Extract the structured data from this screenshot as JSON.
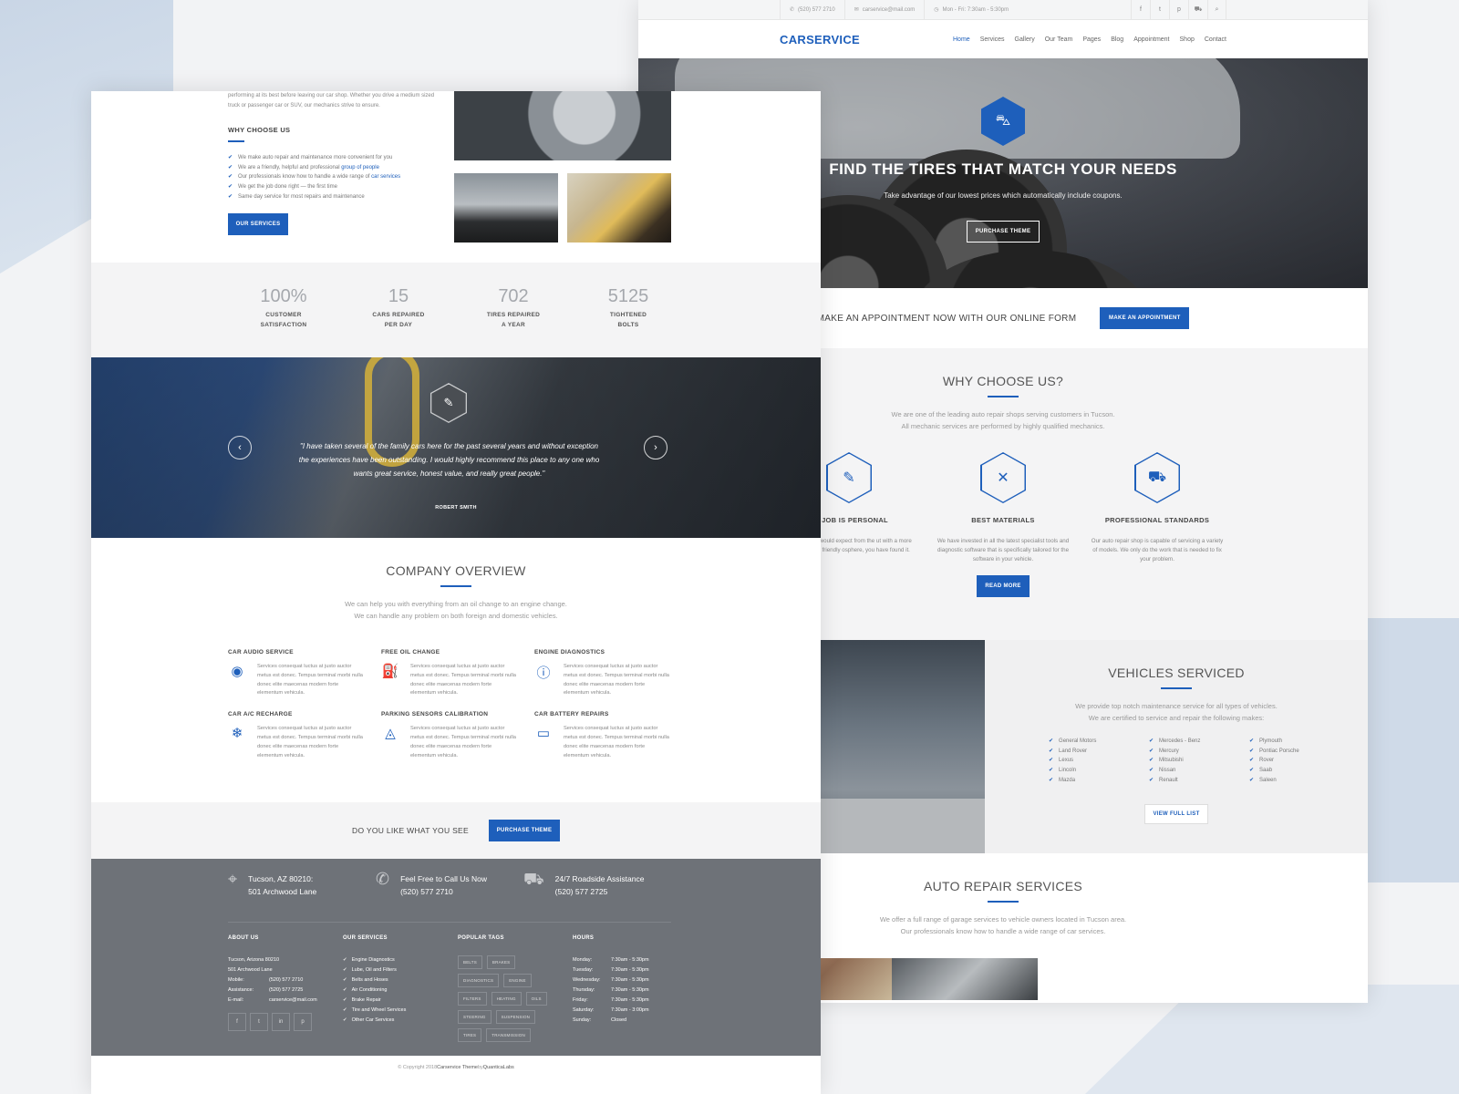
{
  "topbar": {
    "phone": "(520) 577 2710",
    "email": "carservice@mail.com",
    "hours": "Mon - Fri: 7:30am - 5:30pm",
    "icons": [
      "facebook-icon",
      "twitter-icon",
      "pinterest-icon",
      "cart-icon",
      "search-icon"
    ]
  },
  "brand": {
    "logo": "CARSERVICE",
    "accent": "#1e5fbb"
  },
  "nav": [
    "Home",
    "Services",
    "Gallery",
    "Our Team",
    "Pages",
    "Blog",
    "Appointment",
    "Shop",
    "Contact"
  ],
  "hero": {
    "title": "FIND THE TIRES THAT MATCH YOUR NEEDS",
    "subtitle": "Take advantage of our lowest prices which automatically include coupons.",
    "button": "PURCHASE THEME"
  },
  "appointment": {
    "text": "MAKE AN APPOINTMENT NOW WITH OUR ONLINE FORM",
    "button": "MAKE AN APPOINTMENT"
  },
  "why": {
    "title": "WHY CHOOSE US?",
    "sub1": "We are one of the leading auto repair shops serving customers in Tucson.",
    "sub2": "All mechanic services are performed by highly qualified mechanics.",
    "features": [
      {
        "title": "RY JOB IS PERSONAL",
        "text": "e quality you would expect from the ut with a more personal and friendly osphere, you have found it."
      },
      {
        "title": "BEST MATERIALS",
        "text": "We have invested in all the latest specialist tools and diagnostic software that is specifically tailored for the software in your vehicle."
      },
      {
        "title": "PROFESSIONAL STANDARDS",
        "text": "Our auto repair shop is capable of servicing a variety of models. We only do the work that is needed to fix your problem."
      }
    ],
    "button": "READ MORE"
  },
  "vehicles": {
    "title": "VEHICLES SERVICED",
    "sub1": "We provide top notch maintenance service for all types of vehicles.",
    "sub2": "We are certified to service and repair the following makes:",
    "col1": [
      "General Motors",
      "Land Rover",
      "Lexus",
      "Lincoln",
      "Mazda"
    ],
    "col2": [
      "Mercedes - Benz",
      "Mercury",
      "Mitsubishi",
      "Nissan",
      "Renault"
    ],
    "col3": [
      "Plymouth",
      "Pontiac Porsche",
      "Rover",
      "Saab",
      "Saleen"
    ],
    "button": "VIEW FULL LIST"
  },
  "repair": {
    "title": "AUTO REPAIR SERVICES",
    "sub1": "We offer a full range of garage services to vehicle owners located in Tucson area.",
    "sub2": "Our professionals know how to handle a wide range of car services."
  },
  "about": {
    "intro": "performing at its best before leaving our car shop. Whether you drive a medium sized truck or passenger car or SUV, our mechanics strive to ensure.",
    "heading": "WHY CHOOSE US",
    "items": [
      "We make auto repair and maintenance more convenient for you",
      "We are a friendly, helpful and professional ",
      "Our professionals know how to handle a wide range of ",
      "We get the job done right — the first time",
      "Same day service for most repairs and maintenance"
    ],
    "link1": "group of people",
    "link2": "car services",
    "button": "OUR SERVICES"
  },
  "stats": [
    {
      "num": "100%",
      "l1": "CUSTOMER",
      "l2": "SATISFACTION"
    },
    {
      "num": "15",
      "l1": "CARS REPAIRED",
      "l2": "PER DAY"
    },
    {
      "num": "702",
      "l1": "TIRES REPAIRED",
      "l2": "A YEAR"
    },
    {
      "num": "5125",
      "l1": "TIGHTENED",
      "l2": "BOLTS"
    }
  ],
  "testimonial": {
    "quote": "\"I have taken several of the family cars here for the past several years and without exception the experiences have been outstanding. I would highly recommend this place to any one who wants great service, honest value, and really great people.\"",
    "author": "ROBERT SMITH"
  },
  "overview": {
    "title": "COMPANY OVERVIEW",
    "sub1": "We can help you with everything from an oil change to an engine change.",
    "sub2": "We can handle any problem on both foreign and domestic vehicles.",
    "services": [
      {
        "title": "CAR AUDIO SERVICE",
        "icon": "speaker-icon",
        "text": "Services consequat luctus at justo auctor metus est donec. Tempus terminal morbi nulla donec elite maecenas modern forte elementum vehicula."
      },
      {
        "title": "FREE OIL CHANGE",
        "icon": "oil-can-icon",
        "text": "Services consequat luctus at justo auctor metus est donec. Tempus terminal morbi nulla donec elite maecenas modern forte elementum vehicula."
      },
      {
        "title": "ENGINE DIAGNOSTICS",
        "icon": "warning-icon",
        "text": "Services consequat luctus at justo auctor metus est donec. Tempus terminal morbi nulla donec elite maecenas modern forte elementum vehicula."
      },
      {
        "title": "CAR A/C RECHARGE",
        "icon": "thermometer-icon",
        "text": "Services consequat luctus at justo auctor metus est donec. Tempus terminal morbi nulla donec elite maecenas modern forte elementum vehicula."
      },
      {
        "title": "PARKING SENSORS CALIBRATION",
        "icon": "sensor-icon",
        "text": "Services consequat luctus at justo auctor metus est donec. Tempus terminal morbi nulla donec elite maecenas modern forte elementum vehicula."
      },
      {
        "title": "CAR BATTERY REPAIRS",
        "icon": "battery-icon",
        "text": "Services consequat luctus at justo auctor metus est donec. Tempus terminal morbi nulla donec elite maecenas modern forte elementum vehicula."
      }
    ]
  },
  "purchase": {
    "text": "DO YOU LIKE WHAT YOU SEE",
    "button": "PURCHASE THEME"
  },
  "footer": {
    "contacts": [
      {
        "icon": "map-icon",
        "l1": "Tucson, AZ 80210:",
        "l2": "501 Archwood Lane"
      },
      {
        "icon": "phone-icon",
        "l1": "Feel Free to Call Us Now",
        "l2": "(520) 577 2710"
      },
      {
        "icon": "tow-truck-icon",
        "l1": "24/7 Roadside Assistance",
        "l2": "(520) 577 2725"
      }
    ],
    "about_title": "ABOUT US",
    "address1": "Tucson, Arizona 80210",
    "address2": "501 Archwood Lane",
    "rows": [
      {
        "k": "Mobile:",
        "v": "(520) 577 2710"
      },
      {
        "k": "Assistance:",
        "v": "(520) 577 2725"
      },
      {
        "k": "E-mail:",
        "v": "carservice@mail.com"
      }
    ],
    "services_title": "OUR SERVICES",
    "services": [
      "Engine Diagnostics",
      "Lube, Oil and Filters",
      "Belts and Hoses",
      "Air Conditioning",
      "Brake Repair",
      "Tire and Wheel Services",
      "Other Car Services"
    ],
    "tags_title": "POPULAR TAGS",
    "tags": [
      "BELTS",
      "BRAKES",
      "DIAGNOSTICS",
      "ENGINE",
      "FILTERS",
      "HEATING",
      "OILS",
      "STEERING",
      "SUSPENSION",
      "TIRES",
      "TRANSMISSION"
    ],
    "hours_title": "HOURS",
    "hours": [
      {
        "d": "Monday:",
        "h": "7:30am - 5:30pm"
      },
      {
        "d": "Tuesday:",
        "h": "7:30am - 5:30pm"
      },
      {
        "d": "Wednesday:",
        "h": "7:30am - 5:30pm"
      },
      {
        "d": "Thursday:",
        "h": "7:30am - 5:30pm"
      },
      {
        "d": "Friday:",
        "h": "7:30am - 5:30pm"
      },
      {
        "d": "Saturday:",
        "h": "7:30am - 3:00pm"
      },
      {
        "d": "Sunday:",
        "h": "Closed"
      }
    ],
    "copyright_pre": "© Copyright 2018 ",
    "copyright_theme": "Carservice Theme",
    "copyright_by": " by ",
    "copyright_author": "QuanticaLabs"
  }
}
